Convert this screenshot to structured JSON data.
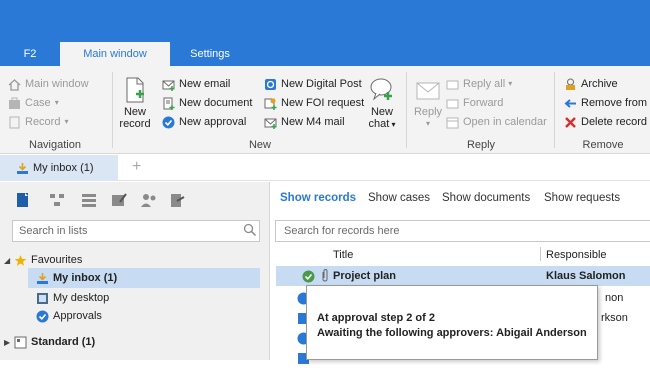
{
  "tabs": {
    "f2": "F2",
    "main": "Main window",
    "settings": "Settings"
  },
  "ribbon": {
    "navigation": {
      "main_window": "Main window",
      "case": "Case",
      "record": "Record",
      "label": "Navigation"
    },
    "new": {
      "new_record_line1": "New",
      "new_record_line2": "record",
      "new_email": "New email",
      "new_document": "New document",
      "new_approval": "New approval",
      "new_digital_post": "New Digital Post",
      "new_foi_request": "New FOI request",
      "new_m4_mail": "New M4 mail",
      "new_chat_line1": "New",
      "new_chat_line2": "chat",
      "label": "New"
    },
    "reply": {
      "reply": "Reply",
      "reply_all": "Reply all",
      "forward": "Forward",
      "open_in_calendar": "Open in calendar",
      "label": "Reply"
    },
    "remove": {
      "archive": "Archive",
      "remove_from": "Remove from li",
      "delete_record": "Delete record",
      "label": "Remove"
    }
  },
  "doctab": {
    "label": "My inbox (1)"
  },
  "left": {
    "search_placeholder": "Search in lists",
    "favourites": "Favourites",
    "my_inbox": "My inbox (1)",
    "my_desktop": "My desktop",
    "approvals": "Approvals",
    "standard": "Standard (1)"
  },
  "right": {
    "tabs": [
      "Show records",
      "Show cases",
      "Show documents",
      "Show requests"
    ],
    "search_placeholder": "Search for records here",
    "col_title": "Title",
    "col_responsible": "Responsible",
    "rows": [
      {
        "title": "Project plan",
        "responsible": "Klaus Salomon"
      },
      {
        "title": "",
        "responsible": "non"
      },
      {
        "title": "",
        "responsible": "rkson"
      },
      {
        "title": "",
        "responsible": ""
      }
    ]
  },
  "tooltip": {
    "line1": "At approval step 2 of 2",
    "line2": "Awaiting the following approvers: Abigail Anderson"
  },
  "colors": {
    "accent": "#2b79d6",
    "selection": "#c7dcf3",
    "ribbon_bg": "#f3f3f3"
  }
}
